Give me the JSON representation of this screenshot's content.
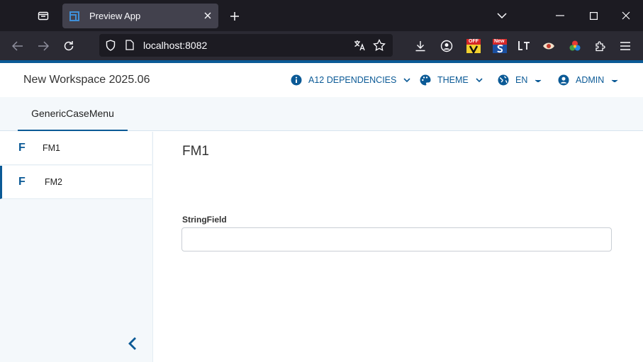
{
  "browser": {
    "tab_title": "Preview App",
    "url": "localhost:8082",
    "extension_badges": {
      "off": "OFF",
      "new": "New"
    }
  },
  "app": {
    "title": "New Workspace 2025.06",
    "menus": [
      {
        "label": "A12 DEPENDENCIES",
        "icon": "info-icon"
      },
      {
        "label": "THEME",
        "icon": "palette-icon"
      },
      {
        "label": "EN",
        "icon": "globe-icon"
      },
      {
        "label": "ADMIN",
        "icon": "user-icon"
      }
    ],
    "subnav": {
      "tab_label": "GenericCaseMenu"
    },
    "sidebar": {
      "items": [
        {
          "badge": "F",
          "label": "FM1"
        },
        {
          "badge": "F",
          "label": "FM2"
        }
      ],
      "active_index": 1
    },
    "form": {
      "title": "FM1",
      "field_label": "StringField",
      "field_value": ""
    }
  },
  "colors": {
    "accent": "#0b5a96",
    "browser_bg": "#1c1b22",
    "toolbar_bg": "#2b2a33"
  }
}
